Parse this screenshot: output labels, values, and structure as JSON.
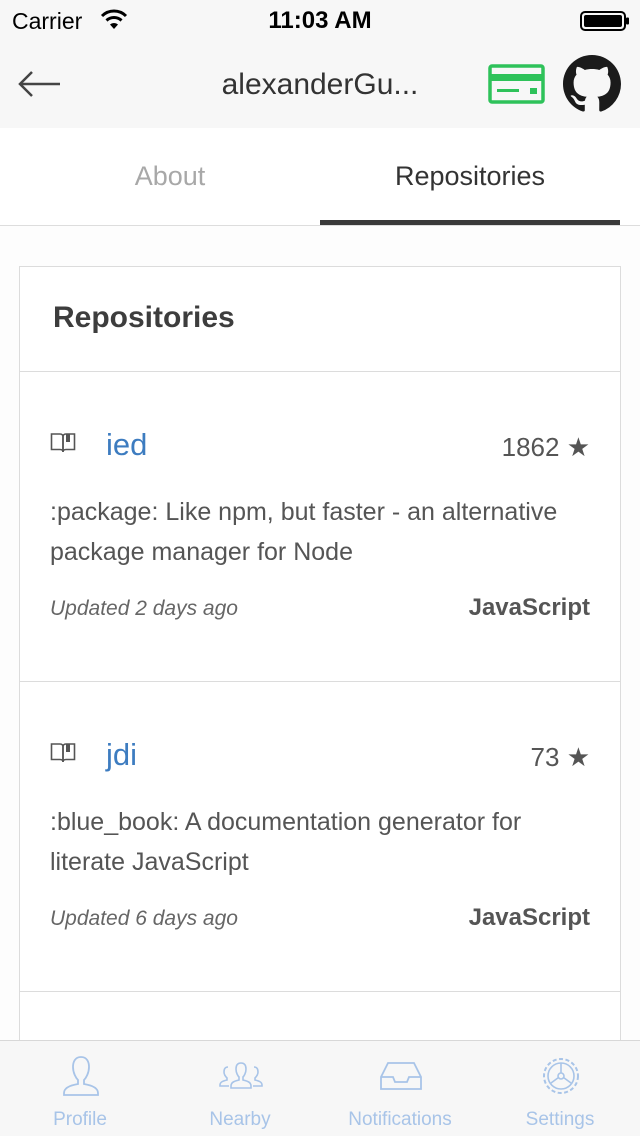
{
  "status_bar": {
    "carrier": "Carrier",
    "time": "11:03 AM"
  },
  "nav": {
    "title": "alexanderGu...",
    "icons": [
      "back-arrow-icon",
      "credit-card-icon",
      "github-icon"
    ],
    "card_color": "#2ec25a"
  },
  "tabs": [
    {
      "label": "About",
      "active": false
    },
    {
      "label": "Repositories",
      "active": true
    }
  ],
  "card": {
    "heading": "Repositories",
    "repos": [
      {
        "name": "ied",
        "stars": "1862 ★",
        "description": ":package: Like npm, but faster - an alternative package manager for Node",
        "updated": "Updated 2 days ago",
        "language": "JavaScript"
      },
      {
        "name": "jdi",
        "stars": "73 ★",
        "description": ":blue_book: A documentation generator for literate JavaScript",
        "updated": "Updated 6 days ago",
        "language": "JavaScript"
      }
    ]
  },
  "bottom_tabs": [
    {
      "label": "Profile",
      "icon": "profile-icon"
    },
    {
      "label": "Nearby",
      "icon": "nearby-icon"
    },
    {
      "label": "Notifications",
      "icon": "inbox-icon"
    },
    {
      "label": "Settings",
      "icon": "gear-icon"
    }
  ],
  "colors": {
    "link": "#3d7cc0",
    "tab_inactive": "#a8c4e8"
  }
}
